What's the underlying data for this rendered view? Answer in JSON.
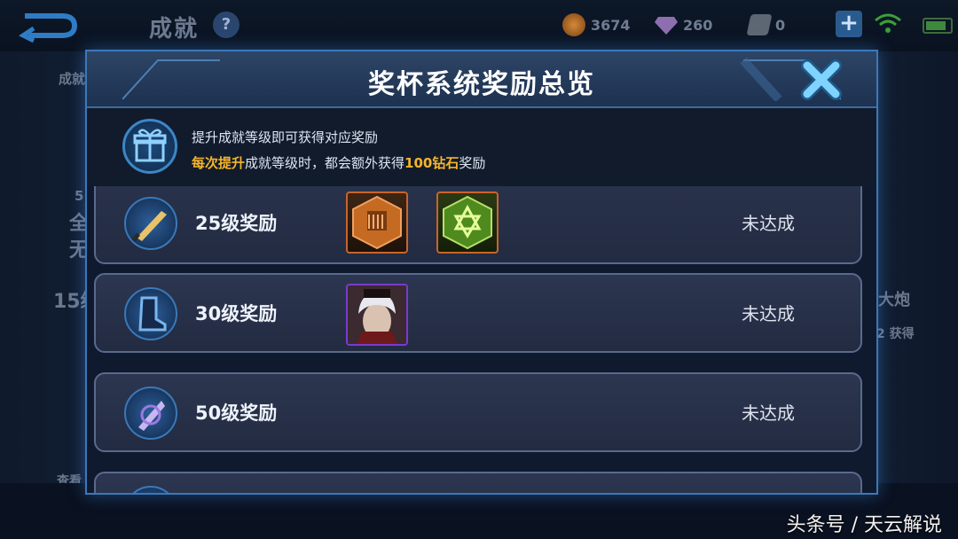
{
  "topbar": {
    "title": "成就",
    "help_symbol": "?",
    "gold": "3674",
    "gems": "260",
    "vouchers": "0",
    "plus_symbol": "+"
  },
  "background": {
    "left_texts": [
      "成就",
      "5",
      "全",
      "无",
      "15级",
      "查看"
    ],
    "right_texts": [
      "大炮",
      "2 获得"
    ]
  },
  "modal": {
    "title": "奖杯系统奖励总览",
    "close_icon": "close-x-icon",
    "info": {
      "line1": "提升成就等级即可获得对应奖励",
      "line2_parts": [
        "每次提升",
        "成就等级时，都会额外获得",
        "100钻石",
        "奖励"
      ]
    },
    "rows": [
      {
        "label": "25级奖励",
        "status": "未达成",
        "rewards": [
          "orange-emblem-icon",
          "green-star-emblem-icon"
        ]
      },
      {
        "label": "30级奖励",
        "status": "未达成",
        "rewards": [
          "hero-portrait"
        ]
      },
      {
        "label": "50级奖励",
        "status": "未达成",
        "rewards": []
      }
    ]
  },
  "watermark": "头条号 / 天云解说",
  "colors": {
    "highlight": "#f5b52b",
    "modal_border": "#3c78b8",
    "row_border": "#5a6a8c",
    "reward_border": "#c9642a"
  }
}
